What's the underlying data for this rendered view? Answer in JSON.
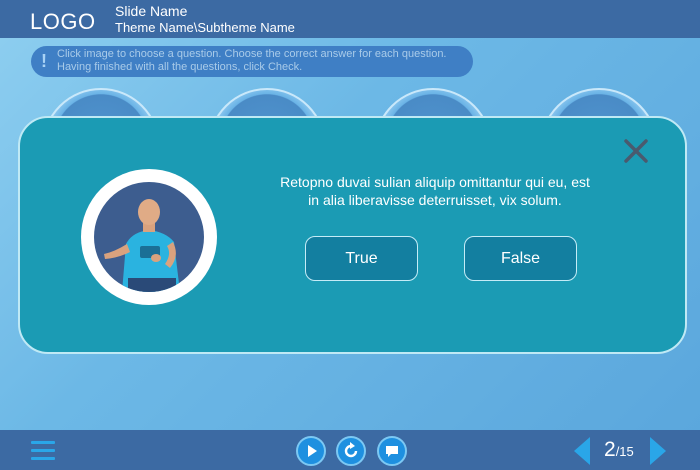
{
  "header": {
    "logo": "LOGO",
    "slide_name": "Slide Name",
    "theme_path": "Theme Name\\Subtheme Name"
  },
  "instructions": {
    "icon": "exclamation-icon",
    "text": "Click image to choose a question. Choose the correct answer for each question. Having finished with all the questions, click Check."
  },
  "modal": {
    "question": "Retopno duvai sulian aliquip omittantur qui eu, est in alia liberavisse deterruisset, vix solum.",
    "answers": [
      "True",
      "False"
    ],
    "close_icon": "close-icon",
    "image": "presenter-photo"
  },
  "footer": {
    "menu_icon": "menu-icon",
    "buttons": [
      "play-icon",
      "replay-icon",
      "comment-icon"
    ],
    "page": {
      "current": "2",
      "total": "/15"
    }
  },
  "colors": {
    "header_bg": "#3c6aa3",
    "modal_bg": "#1b9bb4",
    "button_bg": "#137fa0",
    "accent": "#1e90e0"
  }
}
